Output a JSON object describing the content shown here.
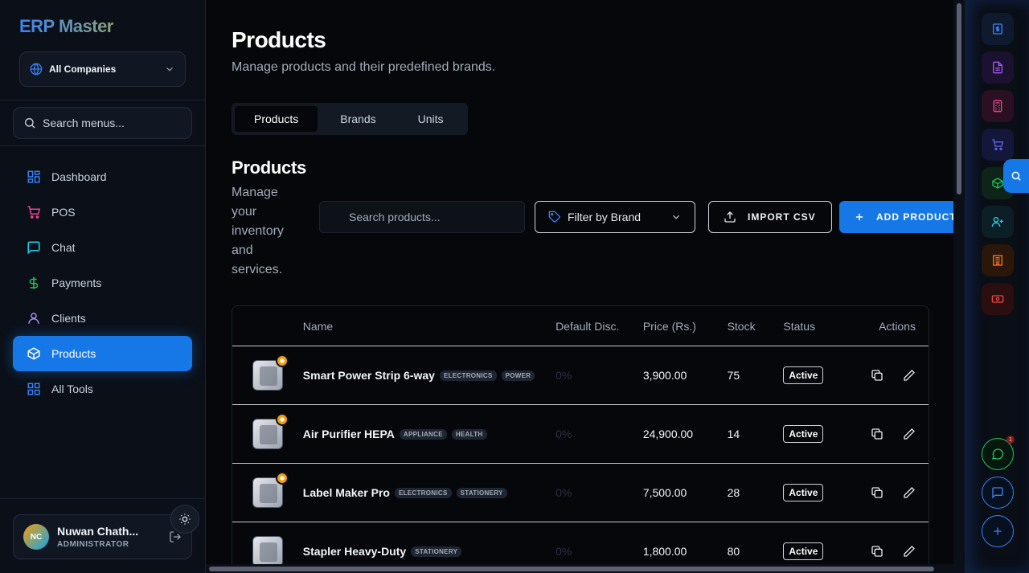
{
  "sidebar": {
    "brand": "ERP Master",
    "company": "All Companies",
    "search_placeholder": "Search menus...",
    "items": [
      {
        "label": "Dashboard",
        "icon": "dashboard-icon",
        "color": "#3b82f6"
      },
      {
        "label": "POS",
        "icon": "cart-icon",
        "color": "#ec4899"
      },
      {
        "label": "Chat",
        "icon": "chat-icon",
        "color": "#22d3ee"
      },
      {
        "label": "Payments",
        "icon": "dollar-icon",
        "color": "#22c55e"
      },
      {
        "label": "Clients",
        "icon": "user-icon",
        "color": "#a78bfa"
      },
      {
        "label": "Products",
        "icon": "box-icon",
        "color": "#ffffff"
      },
      {
        "label": "All Tools",
        "icon": "grid-icon",
        "color": "#3b82f6"
      }
    ],
    "user": {
      "initials": "NC",
      "name": "Nuwan Chath...",
      "role": "ADMINISTRATOR"
    }
  },
  "header": {
    "title": "Products",
    "subtitle": "Manage products and their predefined brands."
  },
  "tabs": [
    {
      "label": "Products",
      "active": true
    },
    {
      "label": "Brands",
      "active": false
    },
    {
      "label": "Units",
      "active": false
    }
  ],
  "section": {
    "title": "Products",
    "subtitle": "Manage your inventory and services.",
    "search_placeholder": "Search products...",
    "filter_label": "Filter by Brand",
    "import_label": "IMPORT CSV",
    "add_label": "ADD PRODUCT"
  },
  "table": {
    "columns": {
      "name": "Name",
      "disc": "Default Disc.",
      "price": "Price (Rs.)",
      "stock": "Stock",
      "status": "Status",
      "actions": "Actions"
    },
    "rows": [
      {
        "name": "Smart Power Strip 6-way",
        "tags": [
          "ELECTRONICS",
          "POWER"
        ],
        "disc": "0%",
        "price": "3,900.00",
        "stock": "75",
        "status": "Active",
        "badge": true
      },
      {
        "name": "Air Purifier HEPA",
        "tags": [
          "APPLIANCE",
          "HEALTH"
        ],
        "disc": "0%",
        "price": "24,900.00",
        "stock": "14",
        "status": "Active",
        "badge": true
      },
      {
        "name": "Label Maker Pro",
        "tags": [
          "ELECTRONICS",
          "STATIONERY"
        ],
        "disc": "0%",
        "price": "7,500.00",
        "stock": "28",
        "status": "Active",
        "badge": true
      },
      {
        "name": "Stapler Heavy-Duty",
        "tags": [
          "STATIONERY"
        ],
        "disc": "0%",
        "price": "1,800.00",
        "stock": "80",
        "status": "Active",
        "badge": false
      }
    ]
  },
  "rail": {
    "buttons": [
      {
        "icon": "invoice-icon",
        "color": "#3b82f6",
        "bg": "#0f1a2e"
      },
      {
        "icon": "document-icon",
        "color": "#a855f7",
        "bg": "#1a1230"
      },
      {
        "icon": "calculator-icon",
        "color": "#ec4899",
        "bg": "#2a1020"
      },
      {
        "icon": "cart-icon",
        "color": "#6366f1",
        "bg": "#14163a"
      },
      {
        "icon": "box-icon",
        "color": "#22c55e",
        "bg": "#0e2418"
      },
      {
        "icon": "user-plus-icon",
        "color": "#22d3ee",
        "bg": "#0c1f26"
      },
      {
        "icon": "building-icon",
        "color": "#f97316",
        "bg": "#2a160a"
      },
      {
        "icon": "cash-icon",
        "color": "#ef4444",
        "bg": "#2a0e10"
      }
    ],
    "notification_count": "1"
  }
}
